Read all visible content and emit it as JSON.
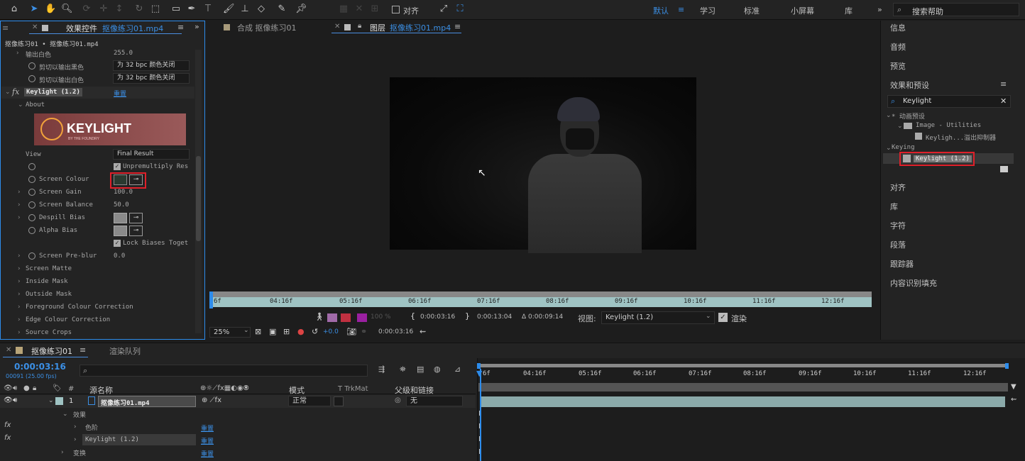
{
  "toolbar": {
    "snap_label": "对齐",
    "workspaces": [
      "默认",
      "学习",
      "标准",
      "小屏幕",
      "库"
    ],
    "search_placeholder": "搜索帮助"
  },
  "effects_panel": {
    "tab_label": "效果控件",
    "tab_file": "抠像练习01.mp4",
    "breadcrumb": "抠像练习01 • 抠像练习01.mp4",
    "rows": {
      "output_white": {
        "label": "输出白色",
        "value": "255.0"
      },
      "clip_black": {
        "label": "剪切以输出黑色",
        "value": "为 32 bpc 颜色关闭"
      },
      "clip_white": {
        "label": "剪切以输出白色",
        "value": "为 32 bpc 颜色关闭"
      },
      "keylight": {
        "label": "Keylight (1.2)",
        "reset": "重置"
      },
      "about": "About",
      "logo_text": "KEYLIGHT",
      "logo_sub": "BY THE FOUNDRY",
      "view": {
        "label": "View",
        "value": "Final Result"
      },
      "unpremultiply": "Unpremultiply Res",
      "screen_colour": "Screen Colour",
      "screen_gain": {
        "label": "Screen Gain",
        "value": "100.0"
      },
      "screen_balance": {
        "label": "Screen Balance",
        "value": "50.0"
      },
      "despill_bias": "Despill Bias",
      "alpha_bias": "Alpha Bias",
      "lock_biases": "Lock Biases Toget",
      "screen_preblur": {
        "label": "Screen Pre-blur",
        "value": "0.0"
      },
      "screen_matte": "Screen Matte",
      "inside_mask": "Inside Mask",
      "outside_mask": "Outside Mask",
      "fg_colour": "Foreground Colour Correction",
      "edge_colour": "Edge Colour Correction",
      "source_crops": "Source Crops"
    }
  },
  "viewer": {
    "tab_comp": "合成 抠像练习01",
    "tab_layer": "图层",
    "tab_layer_file": "抠像练习01.mp4",
    "ruler": [
      "6f",
      "04:16f",
      "05:16f",
      "06:16f",
      "07:16f",
      "08:16f",
      "09:16f",
      "10:16f",
      "11:16f",
      "12:16f"
    ],
    "in_point": "0:00:03:16",
    "out_point": "0:00:13:04",
    "duration": "Δ 0:00:09:14",
    "view_label": "视图:",
    "view_value": "Keylight (1.2)",
    "render_label": "渲染",
    "percent": "100 %",
    "zoom": "25%",
    "exposure": "+0.0",
    "timecode": "0:00:03:16"
  },
  "right_panel": {
    "items_top": [
      "信息",
      "音频",
      "预览"
    ],
    "effects_title": "效果和预设",
    "search_value": "Keylight",
    "tree": {
      "anim_presets": "* 动画预设",
      "image_utilities": "Image - Utilities",
      "keylight_preset": "Keyligh...溢出抑制器",
      "keying": "Keying",
      "keylight_effect": "Keylight (1.2)"
    },
    "items_bottom": [
      "对齐",
      "库",
      "字符",
      "段落",
      "跟踪器",
      "内容识别填充"
    ]
  },
  "timeline": {
    "comp_tab": "抠像练习01",
    "render_queue_tab": "渲染队列",
    "timecode": "0:00:03:16",
    "fps": "00091 (25.00 fps)",
    "col_num": "#",
    "col_source": "源名称",
    "col_mode": "模式",
    "col_trkmat": "T  TrkMat",
    "col_parent": "父级和链接",
    "layer_num": "1",
    "layer_name": "抠像练习01.mp4",
    "layer_mode": "正常",
    "layer_parent": "无",
    "effects_label": "效果",
    "levels": "色阶",
    "keylight": "Keylight (1.2)",
    "transform": "变换",
    "reset": "重置",
    "ruler": [
      "6f",
      "04:16f",
      "05:16f",
      "06:16f",
      "07:16f",
      "08:16f",
      "09:16f",
      "10:16f",
      "11:16f",
      "12:16f"
    ]
  },
  "colors": {
    "accent": "#2d8ceb",
    "highlight": "#e0202a",
    "keylight_bg": "#8a4a4a",
    "timeline_bar": "#9fc3c3"
  }
}
